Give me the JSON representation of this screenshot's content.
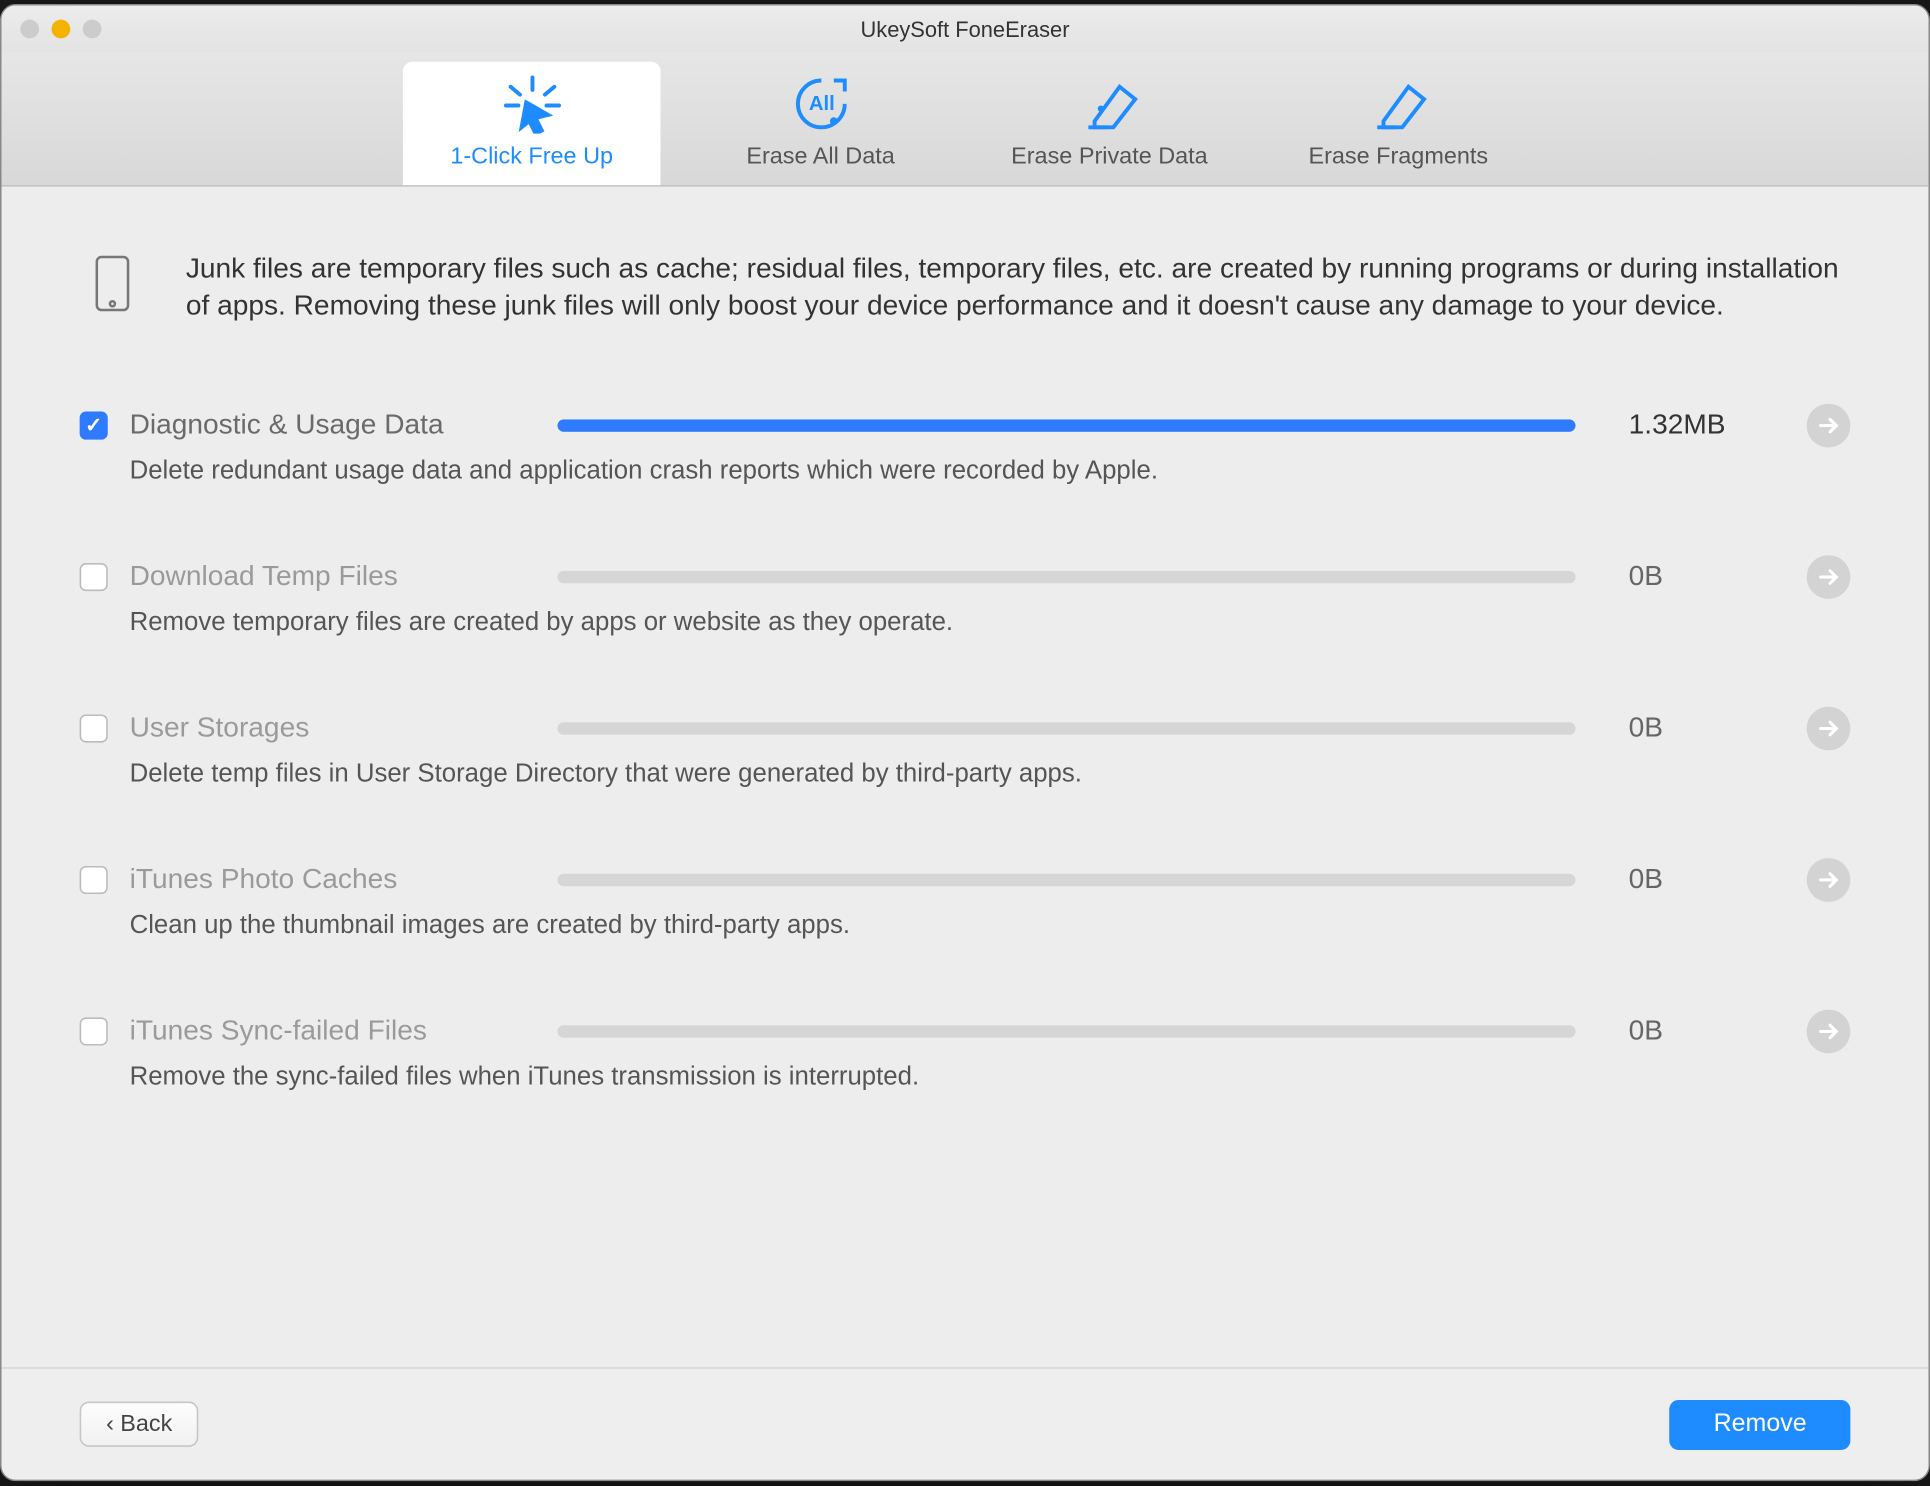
{
  "window": {
    "title": "UkeySoft FoneEraser"
  },
  "tabs": [
    {
      "label": "1-Click Free Up",
      "active": true
    },
    {
      "label": "Erase All Data",
      "active": false
    },
    {
      "label": "Erase Private Data",
      "active": false
    },
    {
      "label": "Erase Fragments",
      "active": false
    }
  ],
  "intro": "Junk files are temporary files such as cache; residual files, temporary files, etc. are created by running programs or during installation of apps. Removing these junk files will only boost your device performance and it doesn't cause any damage to your device.",
  "items": [
    {
      "title": "Diagnostic & Usage Data",
      "desc": "Delete redundant usage data and application crash reports which were recorded by Apple.",
      "size": "1.32MB",
      "checked": true,
      "progress": 100
    },
    {
      "title": "Download Temp Files",
      "desc": "Remove temporary files are created by apps or website as they operate.",
      "size": "0B",
      "checked": false,
      "progress": 0
    },
    {
      "title": "User Storages",
      "desc": "Delete temp files in User Storage Directory that were generated by third-party apps.",
      "size": "0B",
      "checked": false,
      "progress": 0
    },
    {
      "title": "iTunes Photo Caches",
      "desc": "Clean up the thumbnail images are created by third-party apps.",
      "size": "0B",
      "checked": false,
      "progress": 0
    },
    {
      "title": "iTunes Sync-failed Files",
      "desc": "Remove the sync-failed files when iTunes transmission is interrupted.",
      "size": "0B",
      "checked": false,
      "progress": 0
    }
  ],
  "footer": {
    "back": "Back",
    "remove": "Remove"
  }
}
